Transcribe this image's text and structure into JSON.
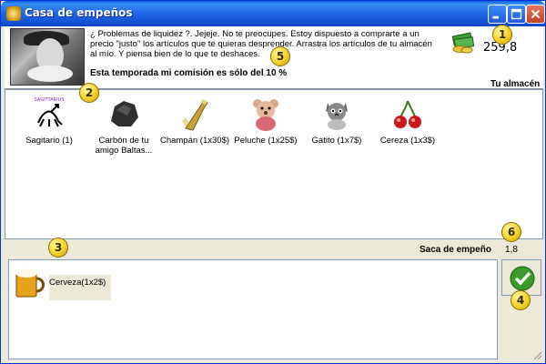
{
  "window": {
    "title": "Casa de empeños",
    "buttons": {
      "minimize": "minimize-icon",
      "maximize": "maximize-icon",
      "close": "close-icon"
    }
  },
  "header": {
    "intro": "¿ Problemas de liquidez ?. Jejeje. No te preocupes. Estoy dispuesto a comprarte a un precio \"justo\" los artículos que te quieras desprender. Arrastra los artículos de tu almacén al mío. Y piensa bien de lo que te deshaces.",
    "commission": "Esta temporada mi comisión es sólo del 10 %",
    "money": "259,8",
    "store_label": "Tu almacén"
  },
  "store": {
    "items": [
      {
        "label": "Sagitario (1)",
        "icon": "sagittarius-icon",
        "top_text": "SAGITTARIUS"
      },
      {
        "label": "Carbón de tu amigo Baltas...",
        "icon": "coal-icon"
      },
      {
        "label": "Champán (1x30$)",
        "icon": "champagne-icon"
      },
      {
        "label": "Peluche (1x25$)",
        "icon": "teddy-bear-icon"
      },
      {
        "label": "Gatito (1x7$)",
        "icon": "kitten-icon"
      },
      {
        "label": "Cereza (1x3$)",
        "icon": "cherry-icon"
      }
    ]
  },
  "pawn": {
    "label": "Saca de empeño",
    "value": "1,8",
    "items": [
      {
        "label": "Cerveza(1x2$)",
        "icon": "beer-icon"
      }
    ]
  },
  "actions": {
    "confirm": "checkmark-icon"
  },
  "badges": [
    "1",
    "2",
    "3",
    "4",
    "5",
    "6"
  ],
  "colors": {
    "title_bar": "#1555D6",
    "badge": "#F4D22A",
    "panel": "#ECE9D8"
  }
}
